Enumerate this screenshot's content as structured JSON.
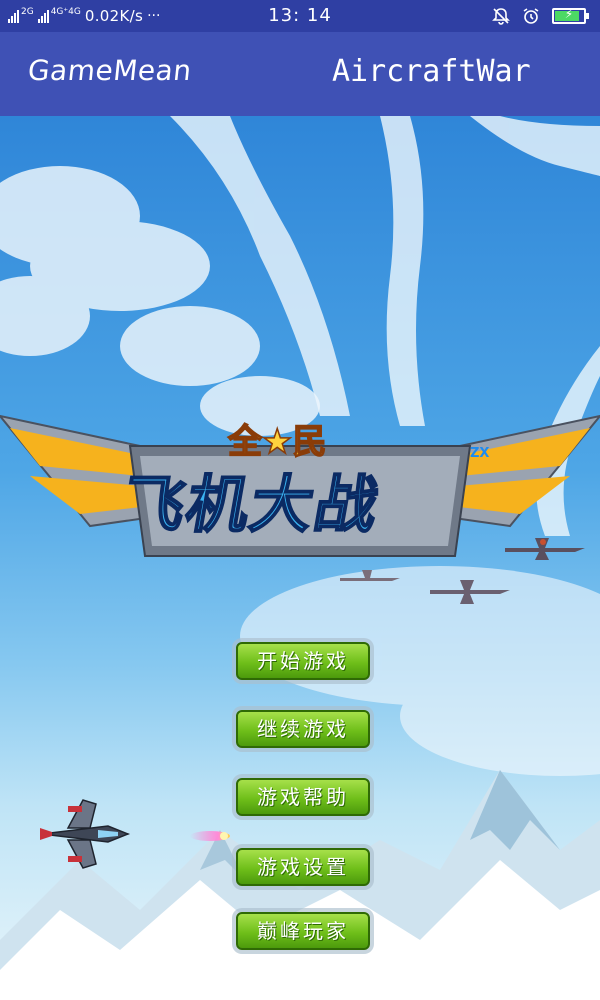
{
  "status_bar": {
    "network_1": "2G",
    "network_2": "4G⁺4G",
    "speed": "0.02K/s",
    "more": "···",
    "time": "13: 14"
  },
  "app_bar": {
    "left_label": "GameMean",
    "title": "AircraftWar"
  },
  "logo": {
    "top_text": "全★民",
    "main_text": "飞机大战",
    "tag": "ZX"
  },
  "menu": {
    "start": "开始游戏",
    "continue": "继续游戏",
    "help": "游戏帮助",
    "settings": "游戏设置",
    "top_players": "巅峰玩家"
  },
  "colors": {
    "app_bar": "#3f51b5",
    "status_bar": "#2f3fa3",
    "button_green": "#6fbf1a",
    "battery": "#4cd964"
  },
  "battery_level": 0.8
}
